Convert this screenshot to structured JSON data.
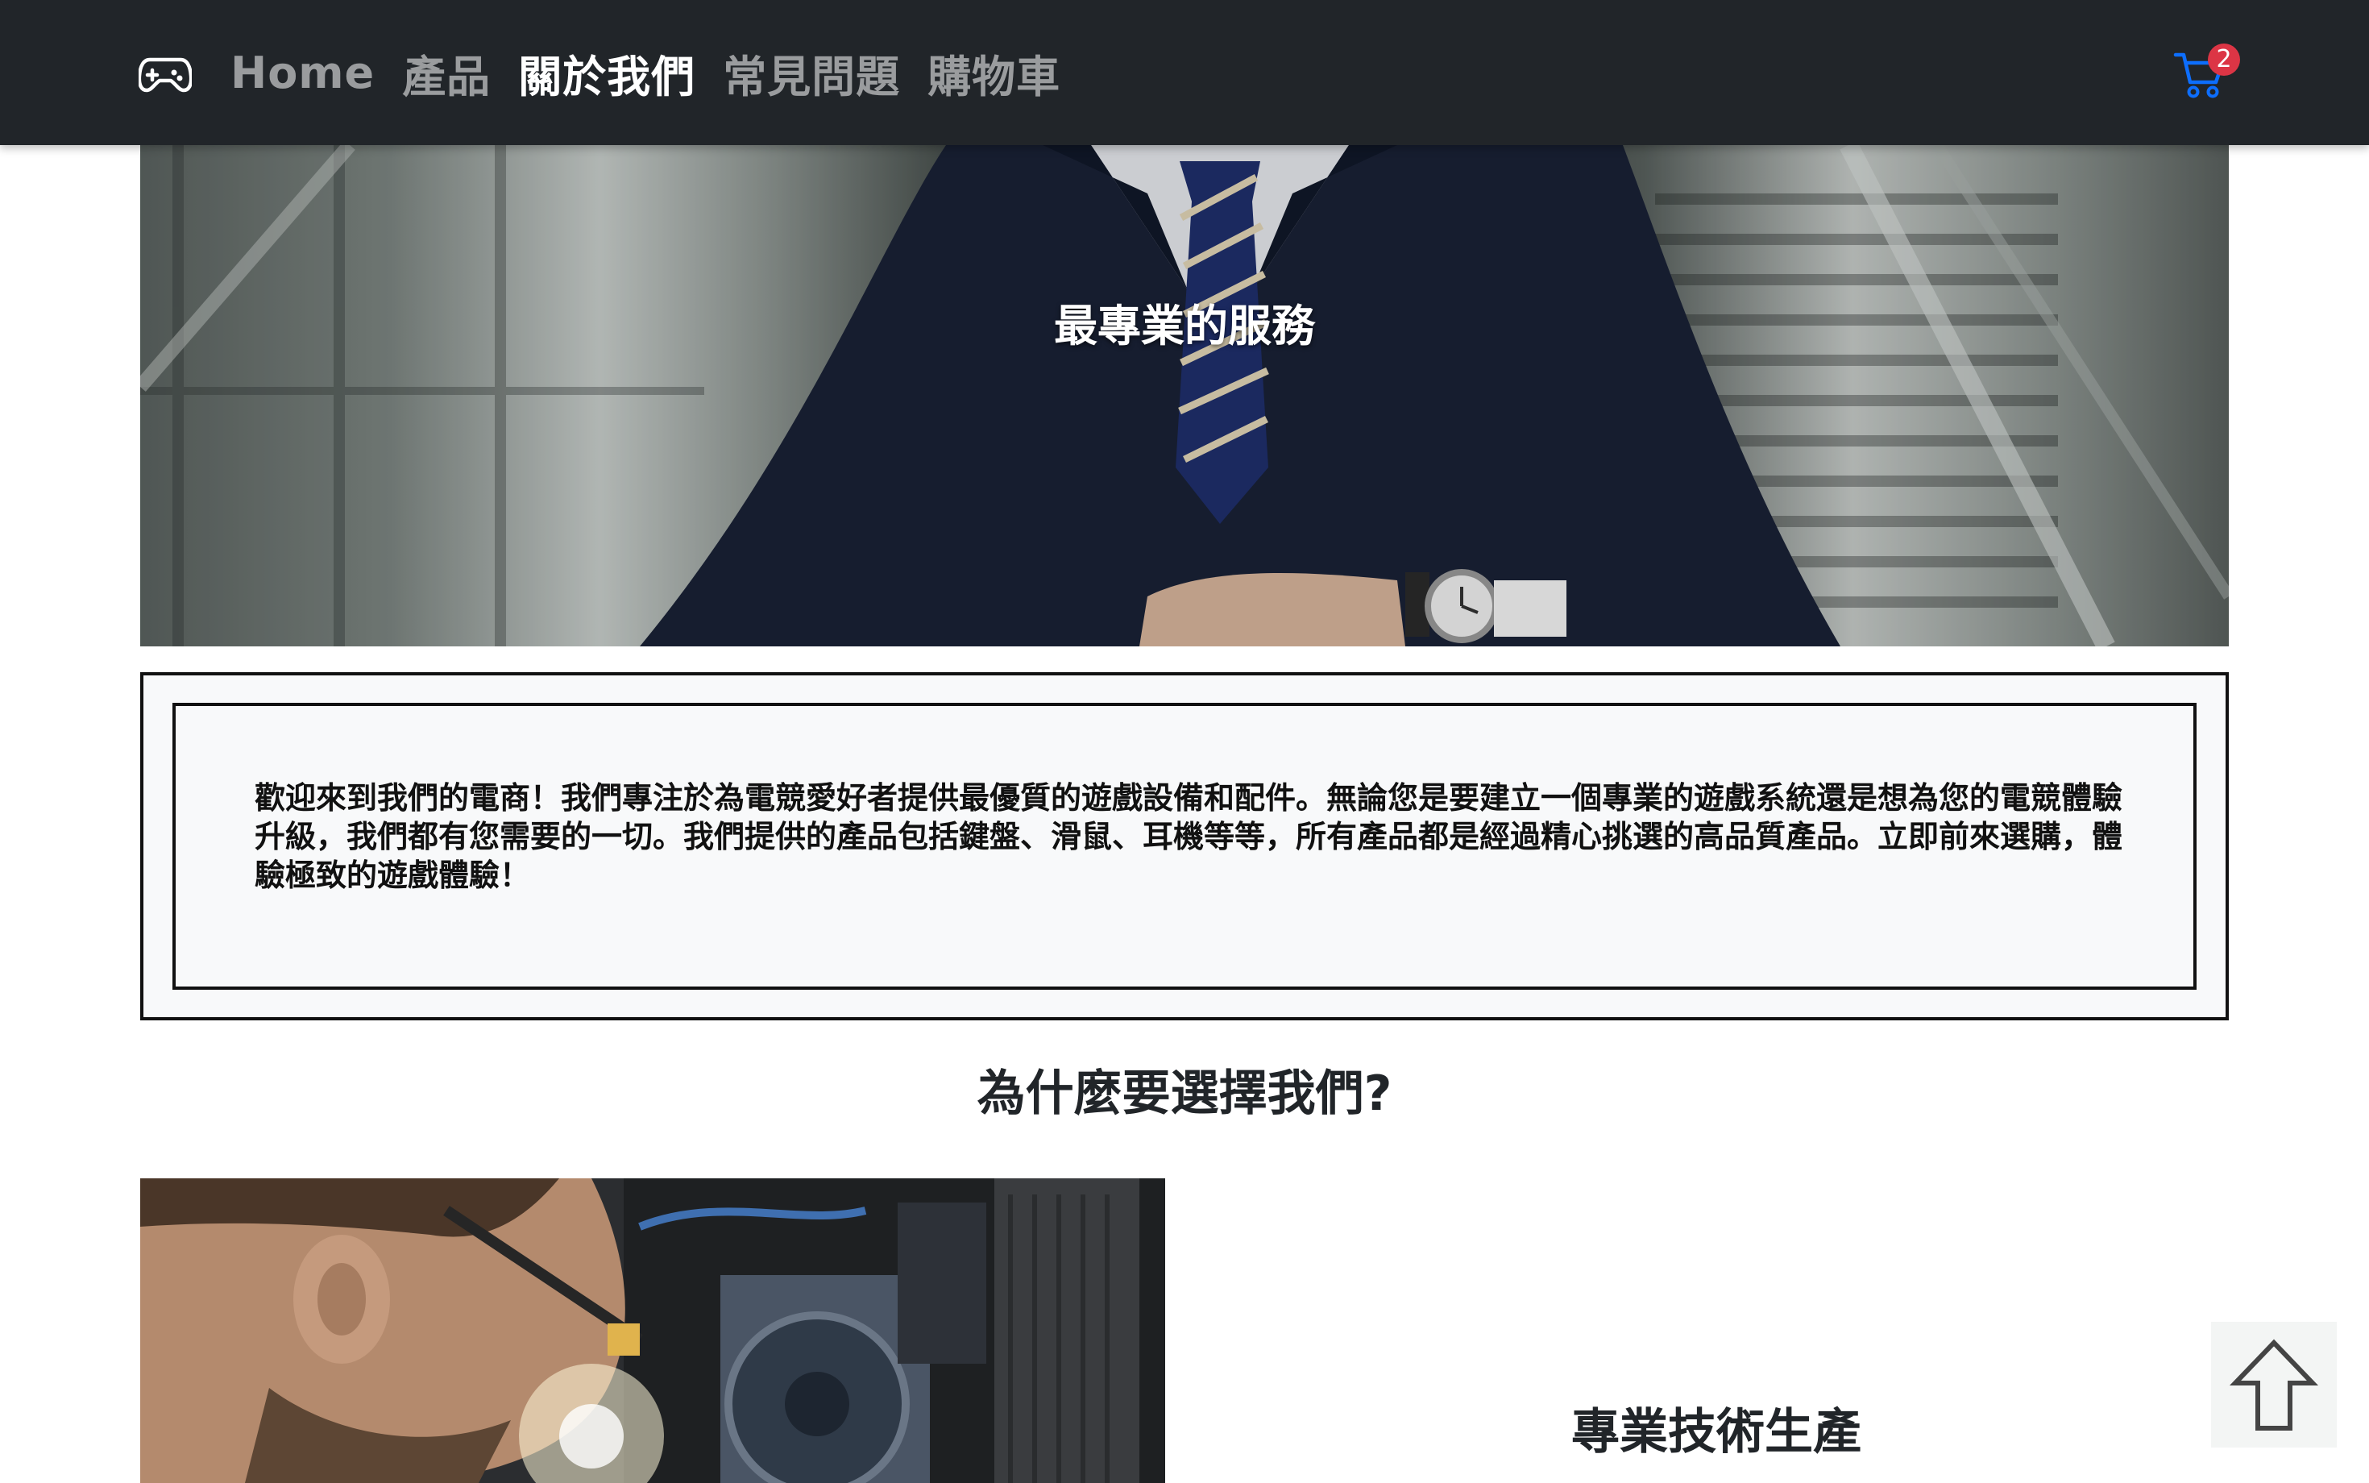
{
  "navbar": {
    "brand_icon": "gamepad-icon",
    "links": [
      {
        "label": "Home",
        "active": false
      },
      {
        "label": "產品",
        "active": false
      },
      {
        "label": "關於我們",
        "active": true
      },
      {
        "label": "常見問題",
        "active": false
      },
      {
        "label": "購物車",
        "active": false
      }
    ],
    "cart_icon": "cart-icon",
    "cart_count": "2"
  },
  "hero": {
    "title": "最專業的服務"
  },
  "intro": {
    "text": "歡迎來到我們的電商！我們專注於為電競愛好者提供最優質的遊戲設備和配件。無論您是要建立一個專業的遊戲系統還是想為您的電競體驗升級，我們都有您需要的一切。我們提供的產品包括鍵盤、滑鼠、耳機等等，所有產品都是經過精心挑選的高品質產品。立即前來選購，體驗極致的遊戲體驗！"
  },
  "why": {
    "heading": "為什麼要選擇我們?",
    "feature_title": "專業技術生產"
  },
  "back_to_top": {
    "icon": "arrow-up-icon"
  },
  "colors": {
    "navbar_bg": "#212529",
    "nav_active": "#ffffff",
    "nav_muted": "rgba(255,255,255,0.55)",
    "cart_icon": "#0d6efd",
    "badge": "#dc3545",
    "intro_bg": "#f8f9fa"
  }
}
